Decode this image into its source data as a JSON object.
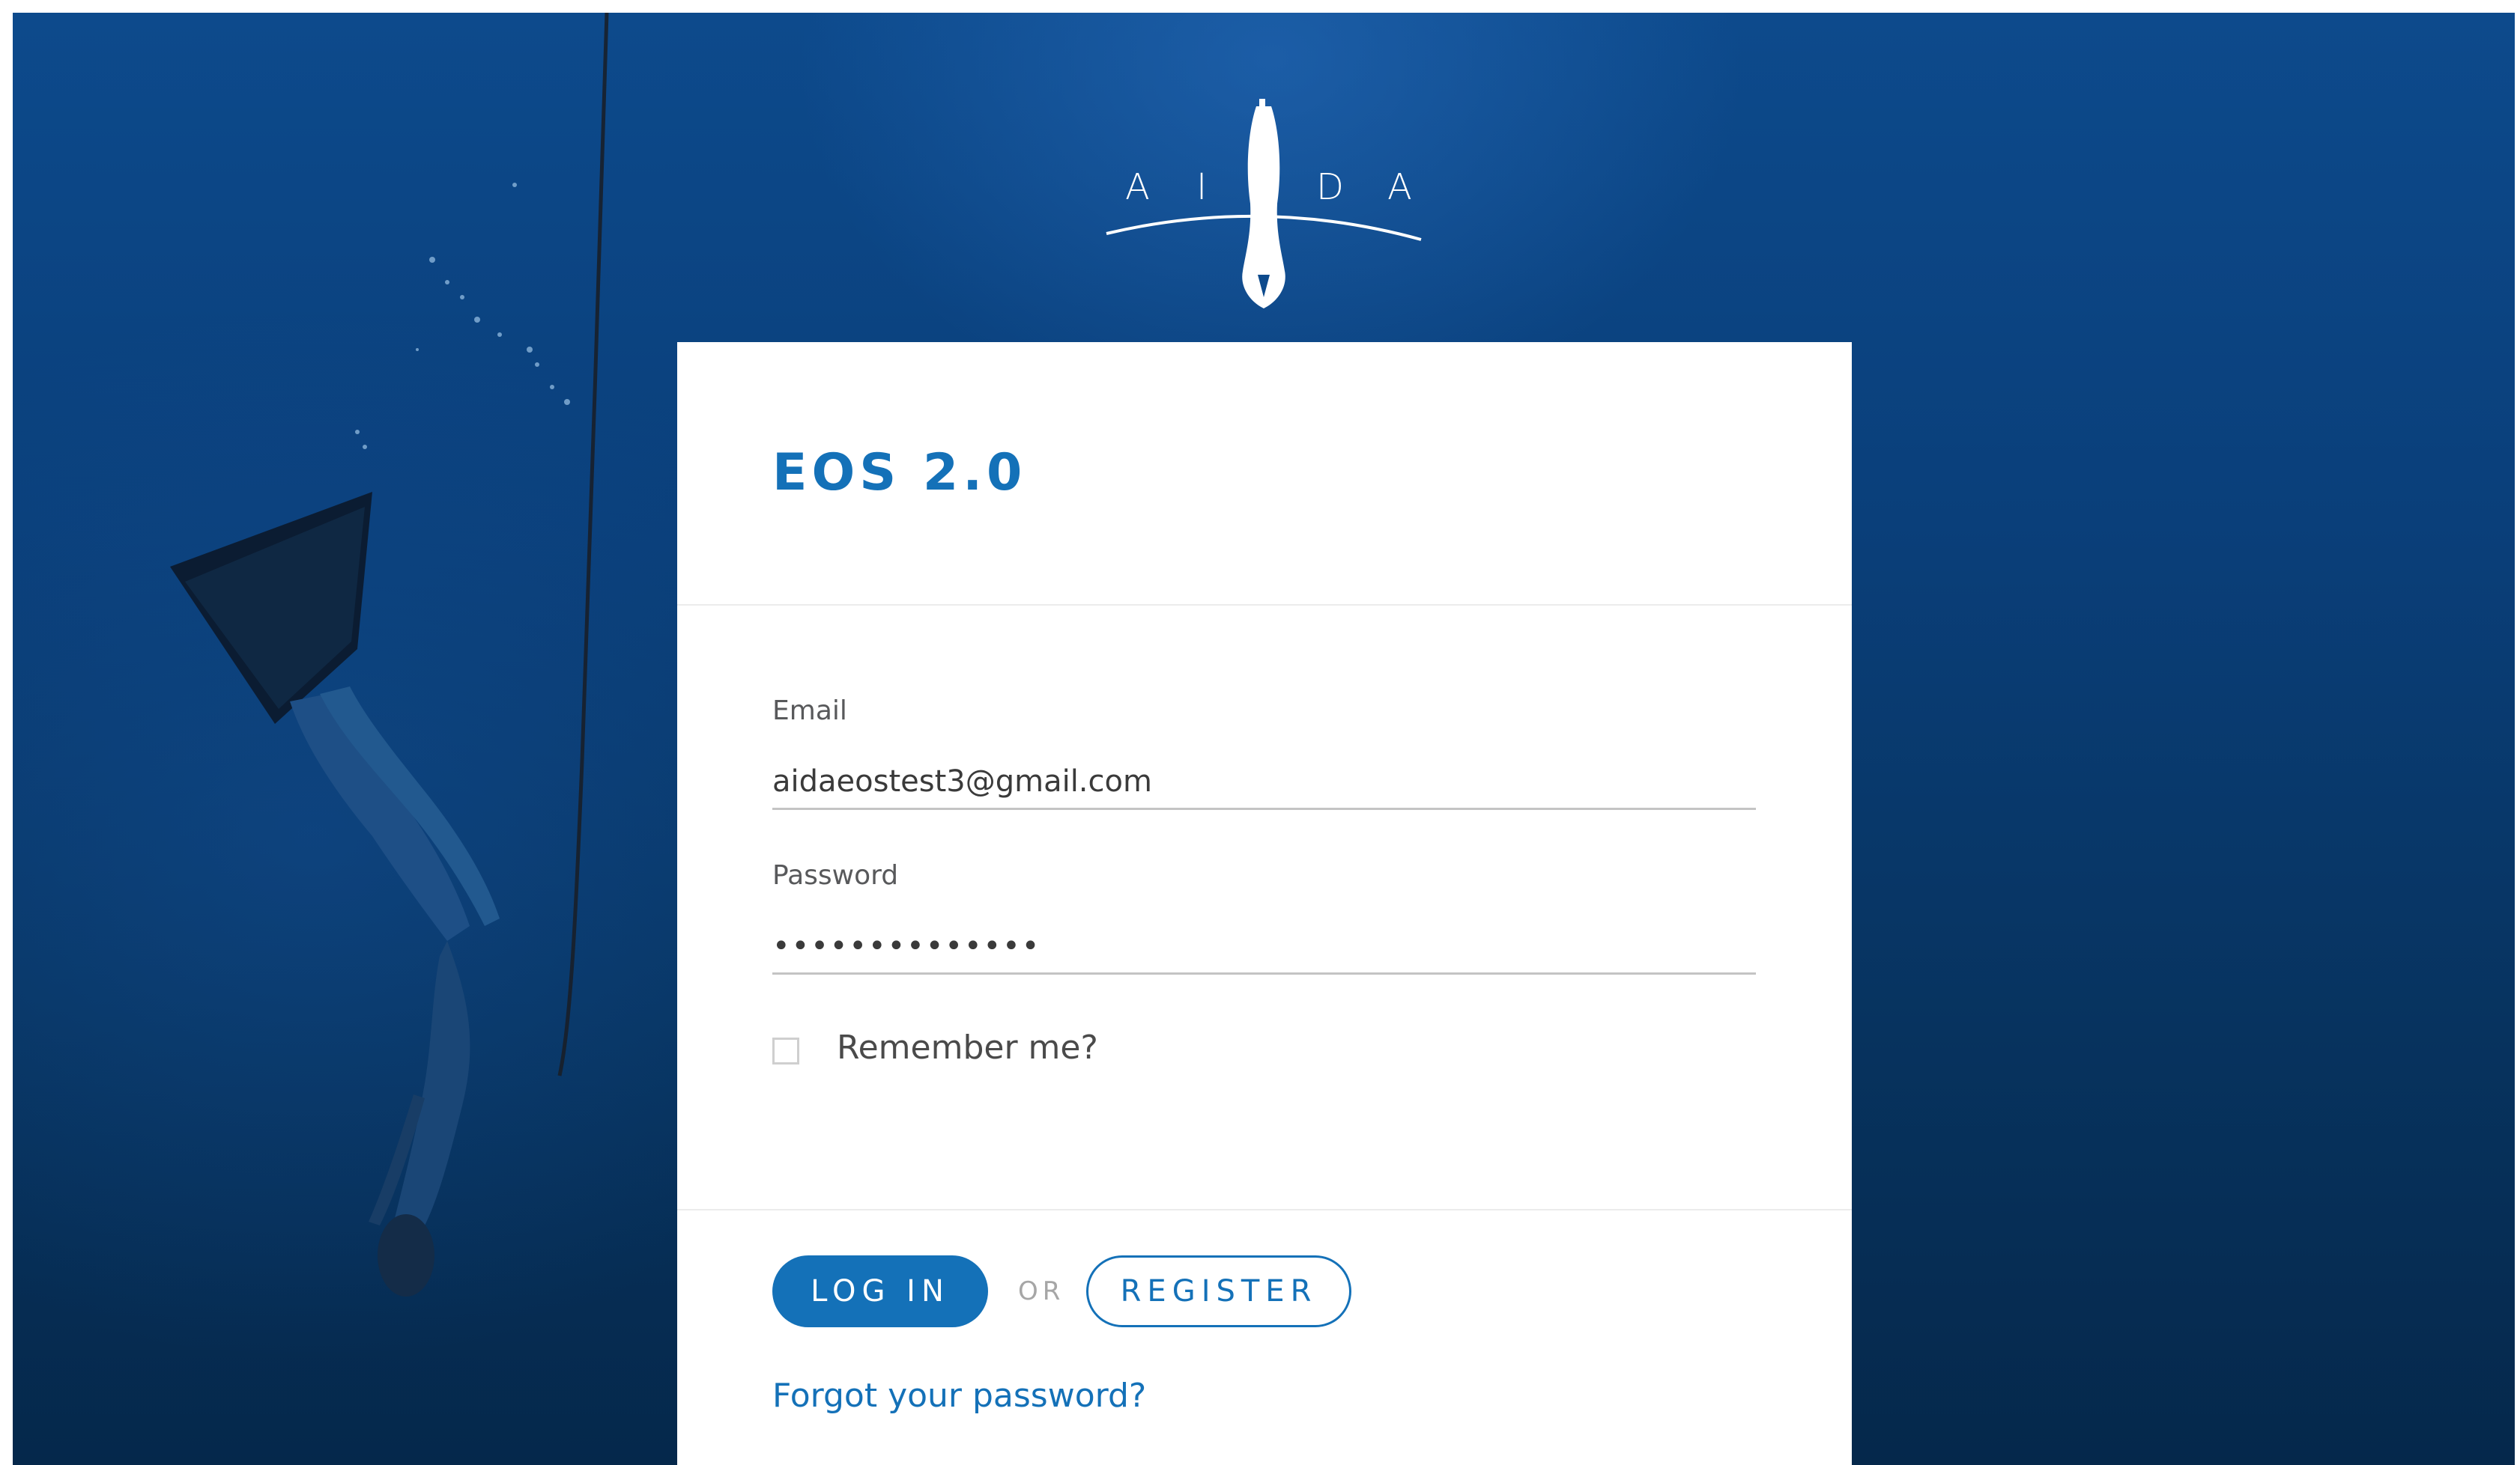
{
  "background": {
    "image": "underwater-freediver-photo",
    "color": "#0a3f7a"
  },
  "logo": {
    "letters": [
      "A",
      "I",
      "D",
      "A"
    ],
    "icon": "diver-logo-icon"
  },
  "card": {
    "title": "EOS 2.0",
    "email": {
      "label": "Email",
      "value": "aidaeostest3@gmail.com"
    },
    "password": {
      "label": "Password",
      "value": "••••••••••••••"
    },
    "remember": {
      "label": "Remember me?",
      "checked": false
    },
    "login_label": "LOG IN",
    "or_label": "OR",
    "register_label": "REGISTER",
    "forgot_label": "Forgot your password?"
  },
  "colors": {
    "accent": "#1471b8",
    "background": "#0a3f7a"
  }
}
